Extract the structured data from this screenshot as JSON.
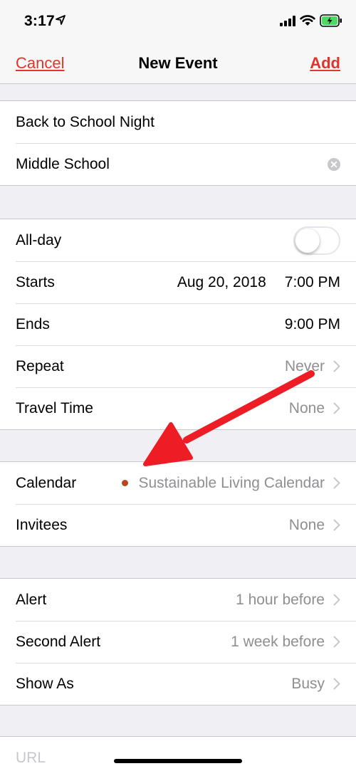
{
  "status_bar": {
    "time": "3:17",
    "icons": [
      "location-icon",
      "signal-icon",
      "wifi-icon",
      "battery-icon"
    ],
    "battery_color": "#4cd964"
  },
  "nav": {
    "cancel_label": "Cancel",
    "title": "New Event",
    "add_label": "Add",
    "accent_color": "#e0352b"
  },
  "event": {
    "title": "Back to School Night",
    "location": "Middle School"
  },
  "timing": {
    "all_day_label": "All-day",
    "all_day_on": false,
    "starts_label": "Starts",
    "starts_date": "Aug 20, 2018",
    "starts_time": "7:00 PM",
    "ends_label": "Ends",
    "ends_time": "9:00 PM",
    "repeat_label": "Repeat",
    "repeat_value": "Never",
    "travel_label": "Travel Time",
    "travel_value": "None"
  },
  "calendar": {
    "calendar_label": "Calendar",
    "calendar_value": "Sustainable Living Calendar",
    "calendar_color": "#b4471e",
    "invitees_label": "Invitees",
    "invitees_value": "None"
  },
  "alerts": {
    "alert_label": "Alert",
    "alert_value": "1 hour before",
    "second_alert_label": "Second Alert",
    "second_alert_value": "1 week before",
    "show_as_label": "Show As",
    "show_as_value": "Busy"
  },
  "url": {
    "placeholder": "URL"
  },
  "annotation": {
    "arrow_color": "#ee1c24"
  }
}
